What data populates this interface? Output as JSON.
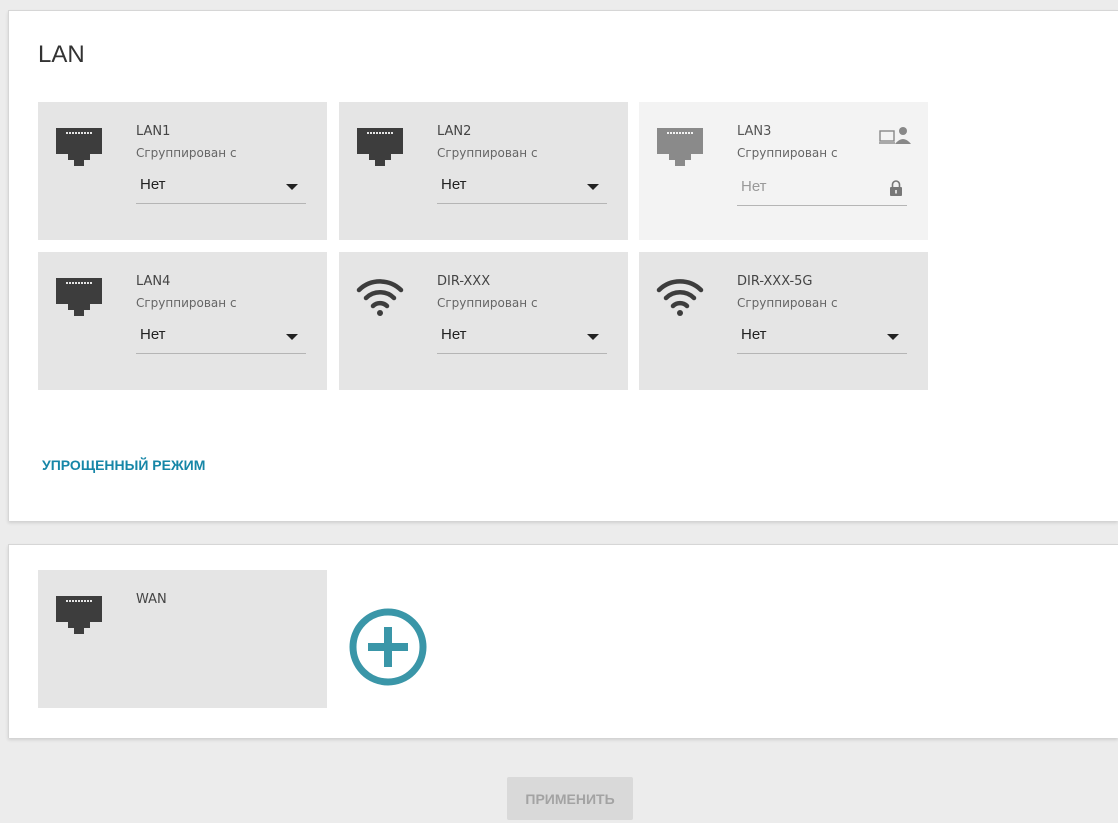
{
  "lan_panel": {
    "title": "LAN",
    "simple_mode_label": "УПРОЩЕННЫЙ РЕЖИМ",
    "cards": [
      {
        "name": "LAN1",
        "subtitle": "Сгруппирован с",
        "value": "Нет",
        "icon": "ethernet-port-icon",
        "disabled": false
      },
      {
        "name": "LAN2",
        "subtitle": "Сгруппирован с",
        "value": "Нет",
        "icon": "ethernet-port-icon",
        "disabled": false
      },
      {
        "name": "LAN3",
        "subtitle": "Сгруппирован с",
        "value": "Нет",
        "icon": "ethernet-port-icon",
        "disabled": true,
        "extra_icons": [
          "computer-user-icon",
          "lock-icon"
        ]
      },
      {
        "name": "LAN4",
        "subtitle": "Сгруппирован с",
        "value": "Нет",
        "icon": "ethernet-port-icon",
        "disabled": false
      },
      {
        "name": "DIR-XXX",
        "subtitle": "Сгруппирован с",
        "value": "Нет",
        "icon": "wifi-icon",
        "disabled": false
      },
      {
        "name": "DIR-XXX-5G",
        "subtitle": "Сгруппирован с",
        "value": "Нет",
        "icon": "wifi-icon",
        "disabled": false
      }
    ]
  },
  "wan_panel": {
    "cards": [
      {
        "name": "WAN",
        "icon": "ethernet-port-icon"
      }
    ],
    "add_icon": "add-circle-icon"
  },
  "footer": {
    "apply_label": "ПРИМЕНИТЬ"
  },
  "colors": {
    "accent": "#3a96a8",
    "link": "#1686a7",
    "card_bg": "#e5e5e5",
    "card_disabled_bg": "#f3f3f3",
    "port_icon": "#3d3d3d",
    "port_icon_disabled": "#8a8a8a"
  }
}
